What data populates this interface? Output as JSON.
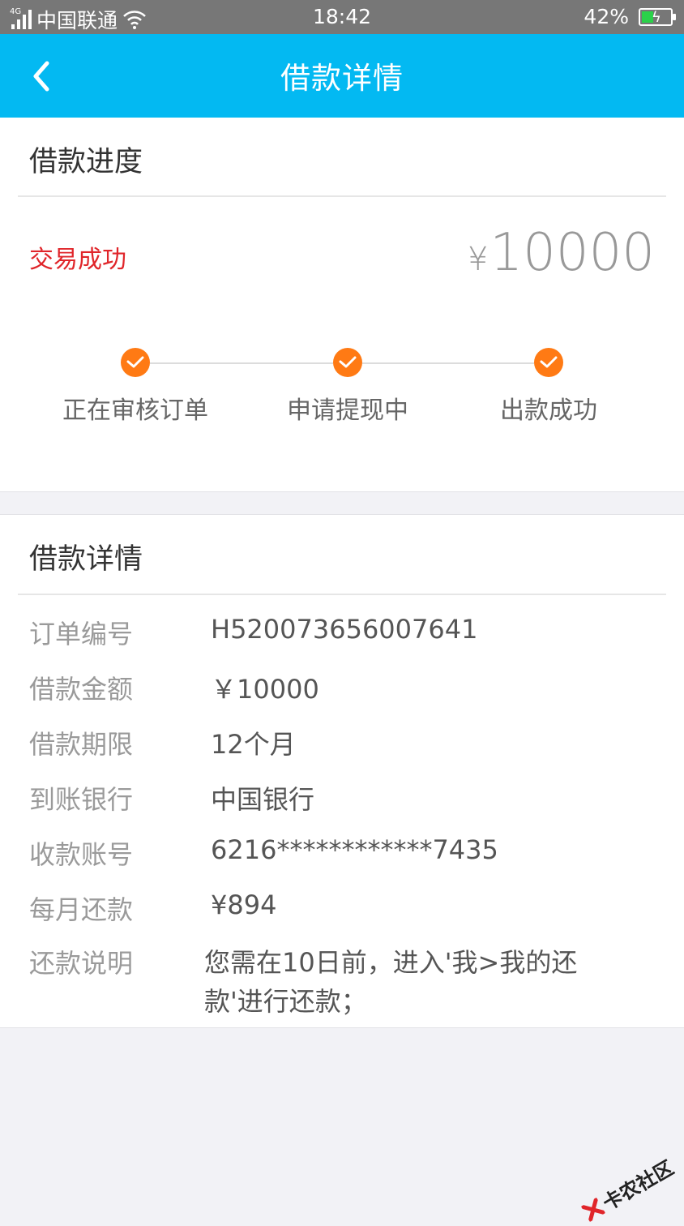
{
  "status_bar": {
    "network": "4G",
    "carrier": "中国联通",
    "time": "18:42",
    "battery": "42%",
    "battery_level": 0.42
  },
  "nav": {
    "title": "借款详情"
  },
  "progress": {
    "section_title": "借款进度",
    "status": "交易成功",
    "amount_currency": "¥",
    "amount": "10000",
    "steps": [
      {
        "label": "正在审核订单"
      },
      {
        "label": "申请提现中"
      },
      {
        "label": "出款成功"
      }
    ]
  },
  "detail": {
    "section_title": "借款详情",
    "rows": [
      {
        "key": "订单编号",
        "value": "H520073656007641"
      },
      {
        "key": "借款金额",
        "value": "￥10000"
      },
      {
        "key": "借款期限",
        "value": "12个月"
      },
      {
        "key": "到账银行",
        "value": "中国银行"
      },
      {
        "key": "收款账号",
        "value": "6216************7435"
      },
      {
        "key": "每月还款",
        "value": "¥894"
      },
      {
        "key": "还款说明",
        "value": "您需在10日前，进入'我>我的还款'进行还款；"
      }
    ]
  },
  "watermark": {
    "text": "卡农社区"
  },
  "colors": {
    "nav_bg": "#03b9f2",
    "status_success": "#e0252a",
    "step_done": "#ff7a14"
  }
}
